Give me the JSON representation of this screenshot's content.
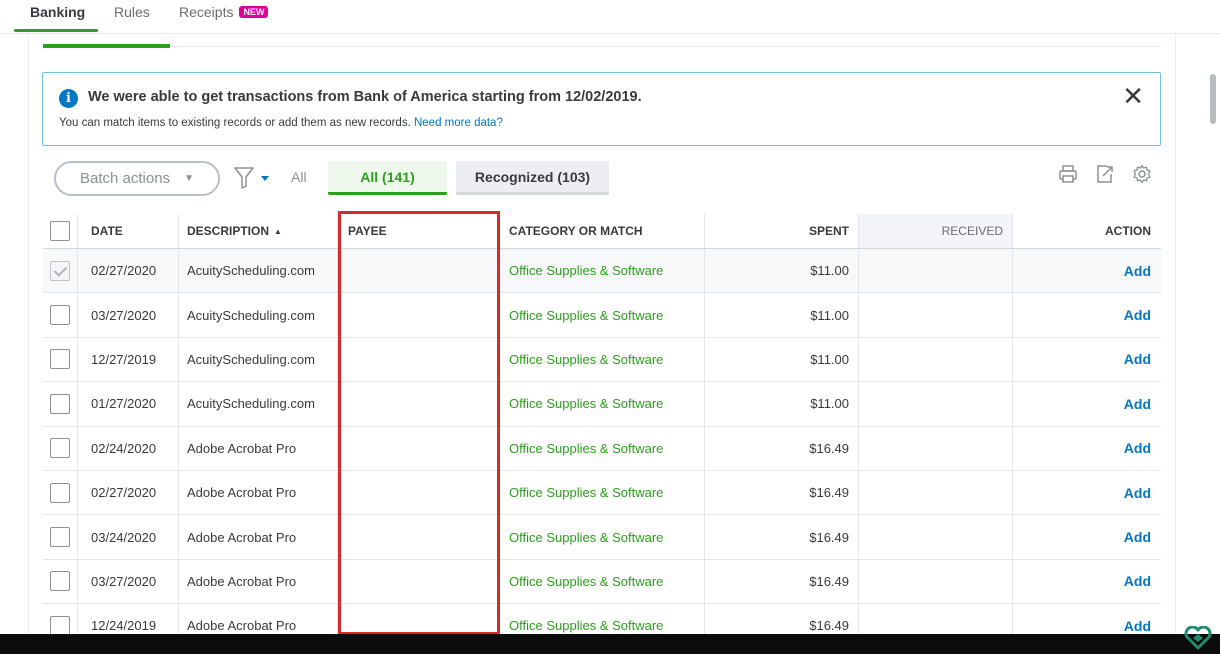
{
  "nav": {
    "tabs": [
      {
        "label": "Banking"
      },
      {
        "label": "Rules"
      },
      {
        "label": "Receipts",
        "badge": "NEW"
      }
    ]
  },
  "banner": {
    "headline": "We were able to get transactions from Bank of America starting from 12/02/2019.",
    "text": "You can match items to existing records or add them as new records.",
    "link": "Need more data?"
  },
  "toolbar": {
    "batch_actions": "Batch actions",
    "all_label": "All",
    "pill_all": "All (141)",
    "pill_recognized": "Recognized (103)"
  },
  "table": {
    "headers": {
      "date": "DATE",
      "description": "DESCRIPTION",
      "payee": "PAYEE",
      "category": "CATEGORY OR MATCH",
      "spent": "SPENT",
      "received": "RECEIVED",
      "action": "ACTION"
    },
    "rows": [
      {
        "date": "02/27/2020",
        "description": "AcuityScheduling.com",
        "payee": "",
        "category": "Office Supplies & Software",
        "spent": "$11.00",
        "received": "",
        "action": "Add"
      },
      {
        "date": "03/27/2020",
        "description": "AcuityScheduling.com",
        "payee": "",
        "category": "Office Supplies & Software",
        "spent": "$11.00",
        "received": "",
        "action": "Add"
      },
      {
        "date": "12/27/2019",
        "description": "AcuityScheduling.com",
        "payee": "",
        "category": "Office Supplies & Software",
        "spent": "$11.00",
        "received": "",
        "action": "Add"
      },
      {
        "date": "01/27/2020",
        "description": "AcuityScheduling.com",
        "payee": "",
        "category": "Office Supplies & Software",
        "spent": "$11.00",
        "received": "",
        "action": "Add"
      },
      {
        "date": "02/24/2020",
        "description": "Adobe Acrobat Pro",
        "payee": "",
        "category": "Office Supplies & Software",
        "spent": "$16.49",
        "received": "",
        "action": "Add"
      },
      {
        "date": "02/27/2020",
        "description": "Adobe Acrobat Pro",
        "payee": "",
        "category": "Office Supplies & Software",
        "spent": "$16.49",
        "received": "",
        "action": "Add"
      },
      {
        "date": "03/24/2020",
        "description": "Adobe Acrobat Pro",
        "payee": "",
        "category": "Office Supplies & Software",
        "spent": "$16.49",
        "received": "",
        "action": "Add"
      },
      {
        "date": "03/27/2020",
        "description": "Adobe Acrobat Pro",
        "payee": "",
        "category": "Office Supplies & Software",
        "spent": "$16.49",
        "received": "",
        "action": "Add"
      },
      {
        "date": "12/24/2019",
        "description": "Adobe Acrobat Pro",
        "payee": "",
        "category": "Office Supplies & Software",
        "spent": "$16.49",
        "received": "",
        "action": "Add"
      }
    ]
  },
  "colors": {
    "brand_green": "#2ca01c",
    "link_blue": "#0077c5",
    "highlight_red": "#d52b2b"
  },
  "icons": [
    "info-icon",
    "close-icon",
    "filter-icon",
    "print-icon",
    "export-icon",
    "gear-icon",
    "sort-up-icon",
    "checkbox-icon"
  ]
}
